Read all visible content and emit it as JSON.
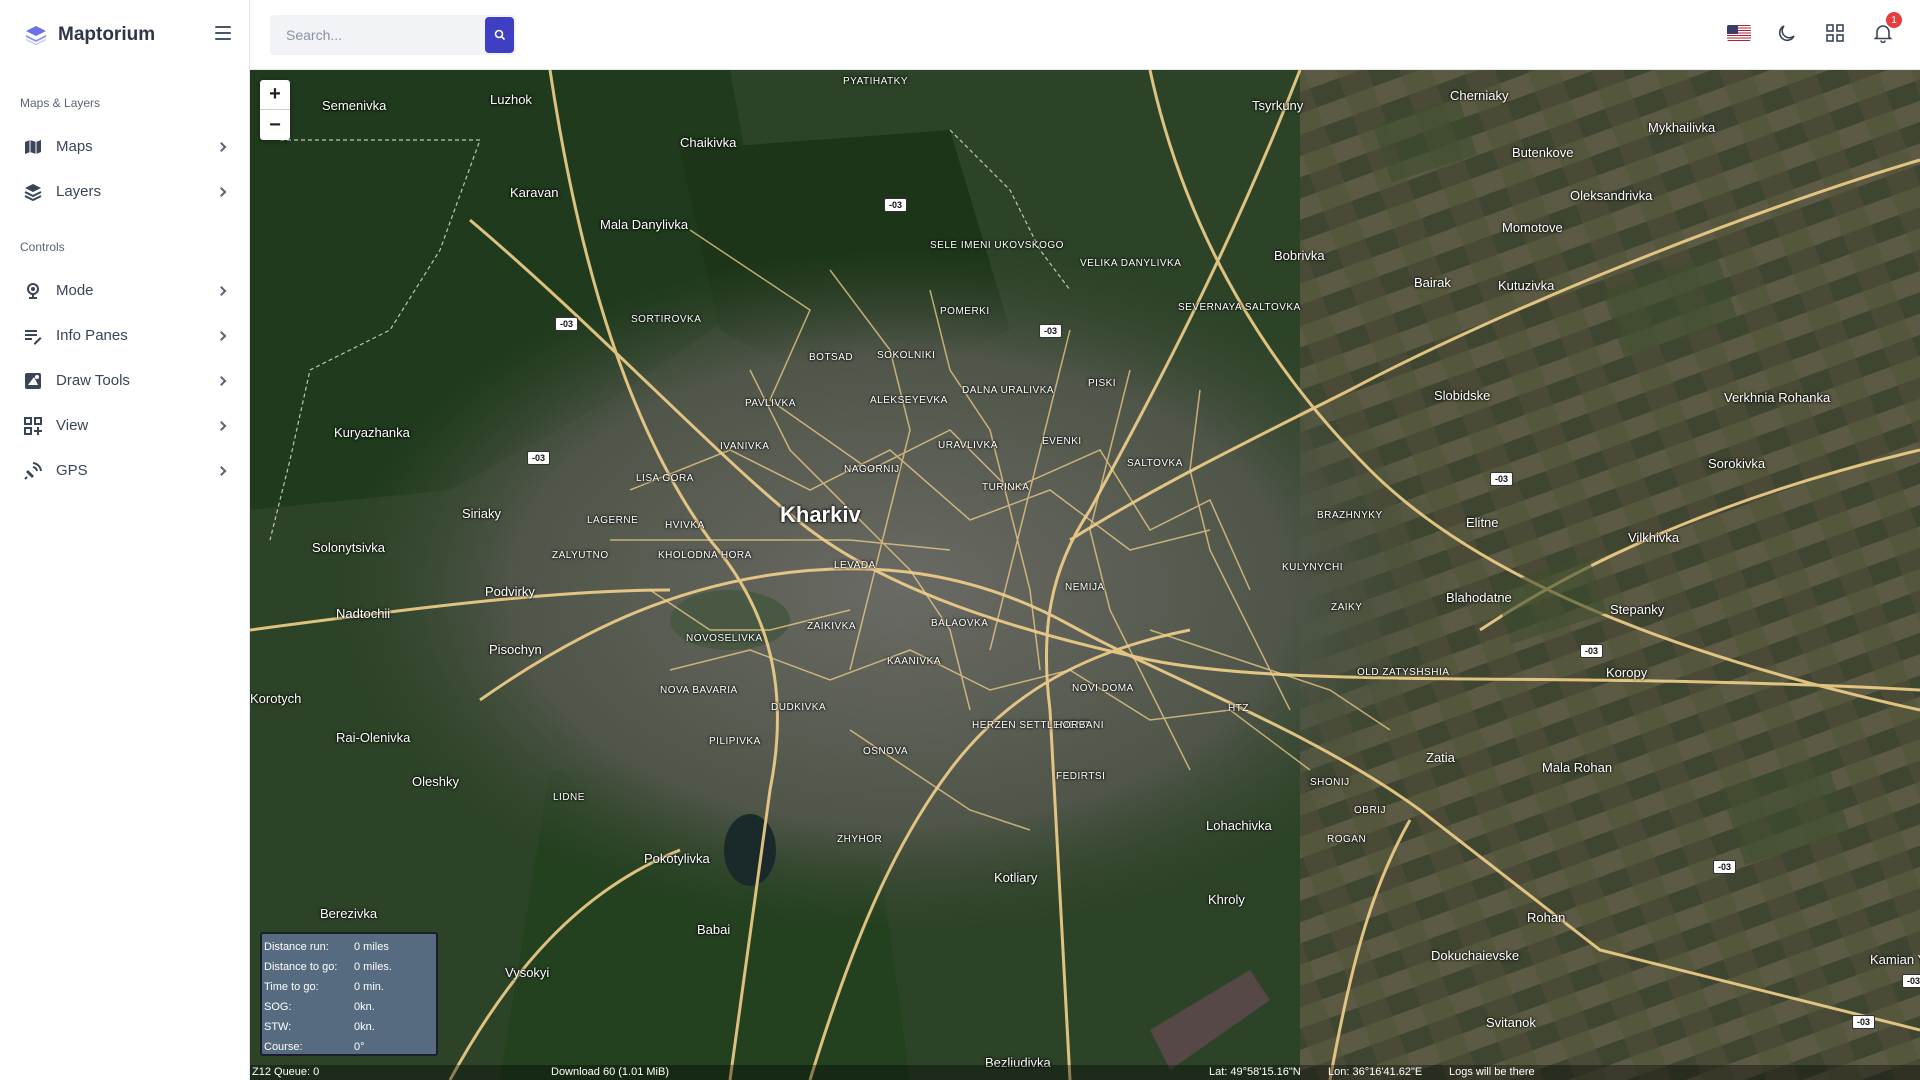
{
  "app": {
    "name": "Maptorium"
  },
  "sidebar": {
    "sections": [
      {
        "title": "Maps & Layers",
        "items": [
          {
            "label": "Maps",
            "icon": "map-icon"
          },
          {
            "label": "Layers",
            "icon": "layers-icon"
          }
        ]
      },
      {
        "title": "Controls",
        "items": [
          {
            "label": "Mode",
            "icon": "mode-icon"
          },
          {
            "label": "Info Panes",
            "icon": "info-panes-icon"
          },
          {
            "label": "Draw Tools",
            "icon": "draw-tools-icon"
          },
          {
            "label": "View",
            "icon": "view-icon"
          },
          {
            "label": "GPS",
            "icon": "gps-icon"
          }
        ]
      }
    ]
  },
  "topbar": {
    "search": {
      "placeholder": "Search..."
    },
    "notifications": {
      "count": "1"
    }
  },
  "map": {
    "zoom_in": "+",
    "zoom_out": "−",
    "places": [
      {
        "text": "Kharkiv",
        "kind": "city"
      },
      {
        "text": "Semenivka"
      },
      {
        "text": "Luzhok"
      },
      {
        "text": "Karavan"
      },
      {
        "text": "Mala Danylivka"
      },
      {
        "text": "Chaikivka"
      },
      {
        "text": "Tsyrkuny"
      },
      {
        "text": "Cherniaky"
      },
      {
        "text": "Mykhailivka"
      },
      {
        "text": "Butenkove"
      },
      {
        "text": "Oleksandrivka"
      },
      {
        "text": "Momotove"
      },
      {
        "text": "Bobrivka"
      },
      {
        "text": "Bairak"
      },
      {
        "text": "Kutuzivka"
      },
      {
        "text": "Slobidske"
      },
      {
        "text": "Verkhnia Rohanka"
      },
      {
        "text": "Sorokivka"
      },
      {
        "text": "Kuryazhanka"
      },
      {
        "text": "Siriaky"
      },
      {
        "text": "Solonytsivka"
      },
      {
        "text": "Podvirky"
      },
      {
        "text": "Nadtochii"
      },
      {
        "text": "Pisochyn"
      },
      {
        "text": "Korotych"
      },
      {
        "text": "Rai-Olenivka"
      },
      {
        "text": "Oleshky"
      },
      {
        "text": "Elitne"
      },
      {
        "text": "Vilkhivka"
      },
      {
        "text": "Blahodatne"
      },
      {
        "text": "Stepanky"
      },
      {
        "text": "Koropy"
      },
      {
        "text": "Zatia"
      },
      {
        "text": "Mala Rohan"
      },
      {
        "text": "Rohan"
      },
      {
        "text": "Lohachivka"
      },
      {
        "text": "Khroly"
      },
      {
        "text": "Kotliary"
      },
      {
        "text": "Pokotylivka"
      },
      {
        "text": "Babai"
      },
      {
        "text": "Berezivka"
      },
      {
        "text": "Vysokyi"
      },
      {
        "text": "Dokuchaievske"
      },
      {
        "text": "Svitanok"
      },
      {
        "text": "Bezliudivka"
      },
      {
        "text": "Kamian Yaruh"
      },
      {
        "text": "PYATIHATKY",
        "kind": "small"
      },
      {
        "text": "SELE IMENI UKOVSKOGO",
        "kind": "small"
      },
      {
        "text": "VELIKA DANYLIVKA",
        "kind": "small"
      },
      {
        "text": "SEVERNAYA SALTOVKA",
        "kind": "small"
      },
      {
        "text": "SORTIROVKA",
        "kind": "small"
      },
      {
        "text": "POMERKI",
        "kind": "small"
      },
      {
        "text": "SOKOLNIKI",
        "kind": "small"
      },
      {
        "text": "BOTSAD",
        "kind": "small"
      },
      {
        "text": "PISKI",
        "kind": "small"
      },
      {
        "text": "PAVLIVKA",
        "kind": "small"
      },
      {
        "text": "ALEKSEYEVKA",
        "kind": "small"
      },
      {
        "text": "DALNA URALIVKA",
        "kind": "small"
      },
      {
        "text": "IVANIVKA",
        "kind": "small"
      },
      {
        "text": "URAVLIVKA",
        "kind": "small"
      },
      {
        "text": "EVENKI",
        "kind": "small"
      },
      {
        "text": "NAGORNIJ",
        "kind": "small"
      },
      {
        "text": "SALTOVKA",
        "kind": "small"
      },
      {
        "text": "LISA GORA",
        "kind": "small"
      },
      {
        "text": "TURINKA",
        "kind": "small"
      },
      {
        "text": "BRAZHNYKY",
        "kind": "small"
      },
      {
        "text": "LAGERNE",
        "kind": "small"
      },
      {
        "text": "HVIVKA",
        "kind": "small"
      },
      {
        "text": "KHOLODNA HORA",
        "kind": "small"
      },
      {
        "text": "ZALYUTNO",
        "kind": "small"
      },
      {
        "text": "LEVADA",
        "kind": "small"
      },
      {
        "text": "KULYNYCHI",
        "kind": "small"
      },
      {
        "text": "NEMIJA",
        "kind": "small"
      },
      {
        "text": "ZAIKY",
        "kind": "small"
      },
      {
        "text": "BALAOVKA",
        "kind": "small"
      },
      {
        "text": "ZAIKIVKA",
        "kind": "small"
      },
      {
        "text": "NOVOSELIVKA",
        "kind": "small"
      },
      {
        "text": "KAANIVKA",
        "kind": "small"
      },
      {
        "text": "OLD ZATYSHSHIA",
        "kind": "small"
      },
      {
        "text": "NOVA BAVARIA",
        "kind": "small"
      },
      {
        "text": "DUDKIVKA",
        "kind": "small"
      },
      {
        "text": "NOVI DOMA",
        "kind": "small"
      },
      {
        "text": "HERZEN SETTLEMENT",
        "kind": "small"
      },
      {
        "text": "HORBANI",
        "kind": "small"
      },
      {
        "text": "PILIPIVKA",
        "kind": "small"
      },
      {
        "text": "OSNOVA",
        "kind": "small"
      },
      {
        "text": "FEDIRTSI",
        "kind": "small"
      },
      {
        "text": "LIDNE",
        "kind": "small"
      },
      {
        "text": "SHONIJ",
        "kind": "small"
      },
      {
        "text": "OBRIJ",
        "kind": "small"
      },
      {
        "text": "ROGAN",
        "kind": "small"
      },
      {
        "text": "ZHYHOR",
        "kind": "small"
      },
      {
        "text": "HTZ",
        "kind": "small"
      }
    ],
    "road_shields": [
      "-03",
      "-03",
      "-03",
      "-03",
      "-03",
      "-03",
      "-03",
      "-03",
      "-03"
    ]
  },
  "info_pane": {
    "rows": [
      {
        "label": "Distance run:",
        "value": "0 miles"
      },
      {
        "label": "Distance to go:",
        "value": "0 miles."
      },
      {
        "label": "Time to go:",
        "value": "0 min."
      },
      {
        "label": "SOG:",
        "value": "0kn."
      },
      {
        "label": "STW:",
        "value": "0kn."
      },
      {
        "label": "Course:",
        "value": "0°"
      }
    ]
  },
  "status": {
    "zoom_queue": "Z12  Queue: 0",
    "download": "Download 60 (1.01 MiB)",
    "lat": "Lat: 49°58'15.16\"N",
    "lon": "Lon: 36°16'41.62\"E",
    "logs": "Logs will be there"
  }
}
